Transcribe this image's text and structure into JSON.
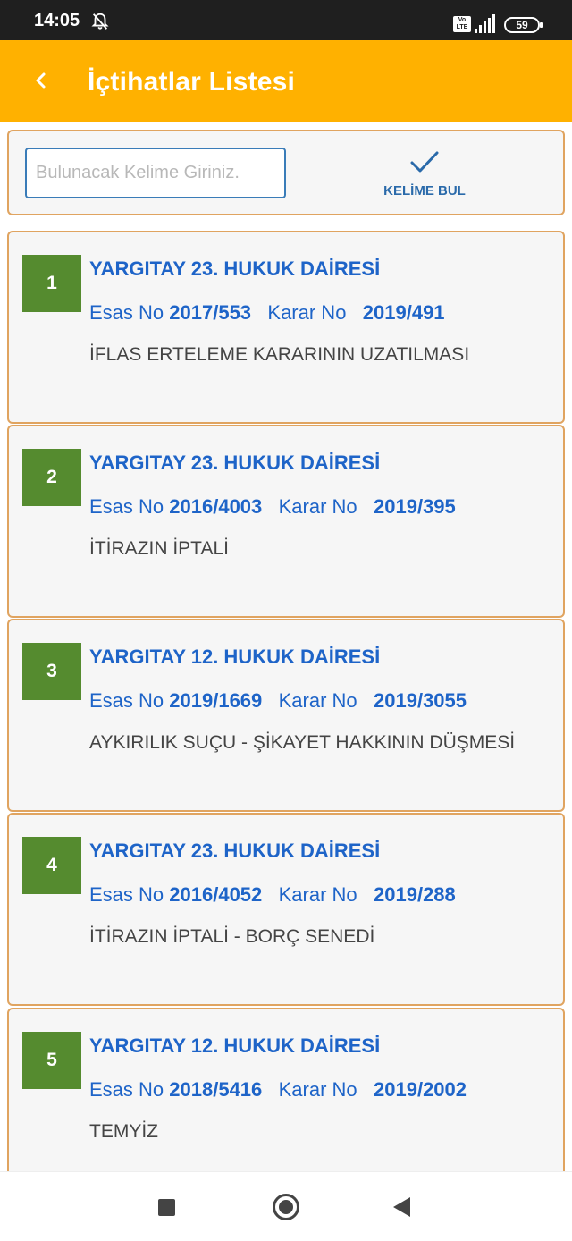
{
  "status_bar": {
    "time": "14:05",
    "volte": "Vo LTE",
    "battery": "59"
  },
  "app_bar": {
    "title": "İçtihatlar Listesi"
  },
  "search": {
    "placeholder": "Bulunacak Kelime Giriniz.",
    "value": "",
    "button_label": "KELİME BUL"
  },
  "labels": {
    "esas": "Esas No",
    "karar": "Karar No"
  },
  "results": [
    {
      "num": "1",
      "court": "YARGITAY 23. HUKUK DAİRESİ",
      "esas_no": "2017/553",
      "karar_no": "2019/491",
      "subject": "İFLAS ERTELEME KARARININ UZATILMASI"
    },
    {
      "num": "2",
      "court": "YARGITAY 23. HUKUK DAİRESİ",
      "esas_no": "2016/4003",
      "karar_no": "2019/395",
      "subject": "İTİRAZIN İPTALİ"
    },
    {
      "num": "3",
      "court": "YARGITAY 12. HUKUK DAİRESİ",
      "esas_no": "2019/1669",
      "karar_no": "2019/3055",
      "subject": "AYKIRILIK SUÇU - ŞİKAYET HAKKININ DÜŞMESİ"
    },
    {
      "num": "4",
      "court": "YARGITAY 23. HUKUK DAİRESİ",
      "esas_no": "2016/4052",
      "karar_no": "2019/288",
      "subject": "İTİRAZIN İPTALİ - BORÇ SENEDİ"
    },
    {
      "num": "5",
      "court": "YARGITAY 12. HUKUK DAİRESİ",
      "esas_no": "2018/5416",
      "karar_no": "2019/2002",
      "subject": "TEMYİZ"
    }
  ],
  "colors": {
    "app_bar": "#ffb100",
    "badge": "#558b2f",
    "link_blue": "#1e64c8",
    "card_border": "#e0a460"
  }
}
